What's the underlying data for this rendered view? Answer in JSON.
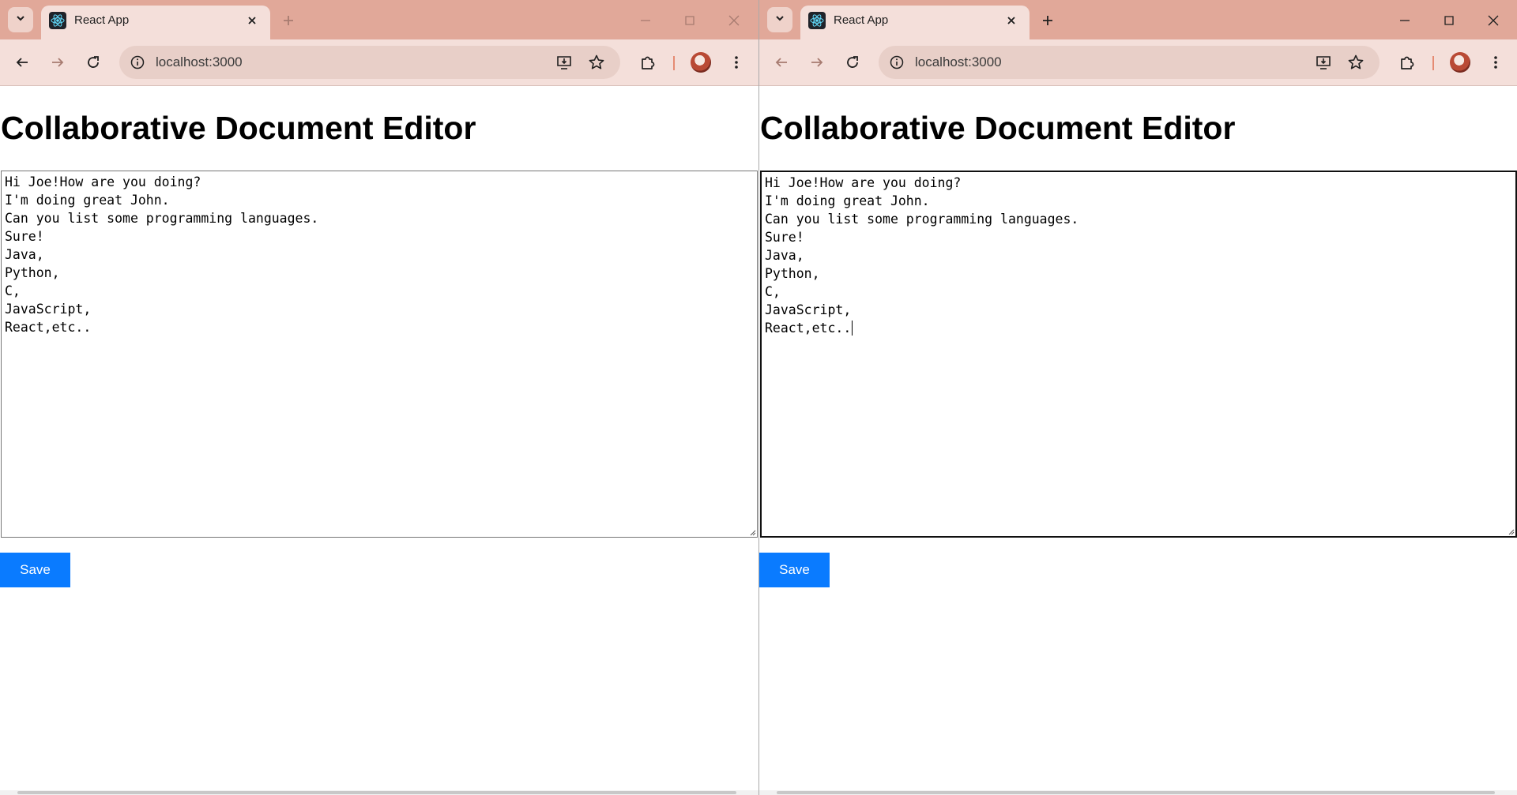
{
  "browser": {
    "tab_title": "React App",
    "url": "localhost:3000"
  },
  "page": {
    "heading": "Collaborative Document Editor",
    "save_label": "Save"
  },
  "document": {
    "lines": [
      "Hi Joe!How are you doing?",
      "I'm doing great John.",
      "Can you list some programming languages.",
      "Sure!",
      "Java,",
      "Python,",
      "C,",
      "JavaScript,",
      "React,etc.."
    ]
  },
  "icons": {
    "tab_search": "chevron-down-icon",
    "favicon": "react-logo-icon",
    "tab_close": "close-icon",
    "new_tab": "plus-icon",
    "back": "arrow-left-icon",
    "forward": "arrow-right-icon",
    "reload": "reload-icon",
    "site_info": "info-icon",
    "install": "install-app-icon",
    "bookmark": "star-icon",
    "extensions": "puzzle-icon",
    "menu": "kebab-menu-icon"
  },
  "colors": {
    "titlebar": "#e1a899",
    "toolbar": "#f4dfda",
    "save_button": "#0a7bff"
  }
}
